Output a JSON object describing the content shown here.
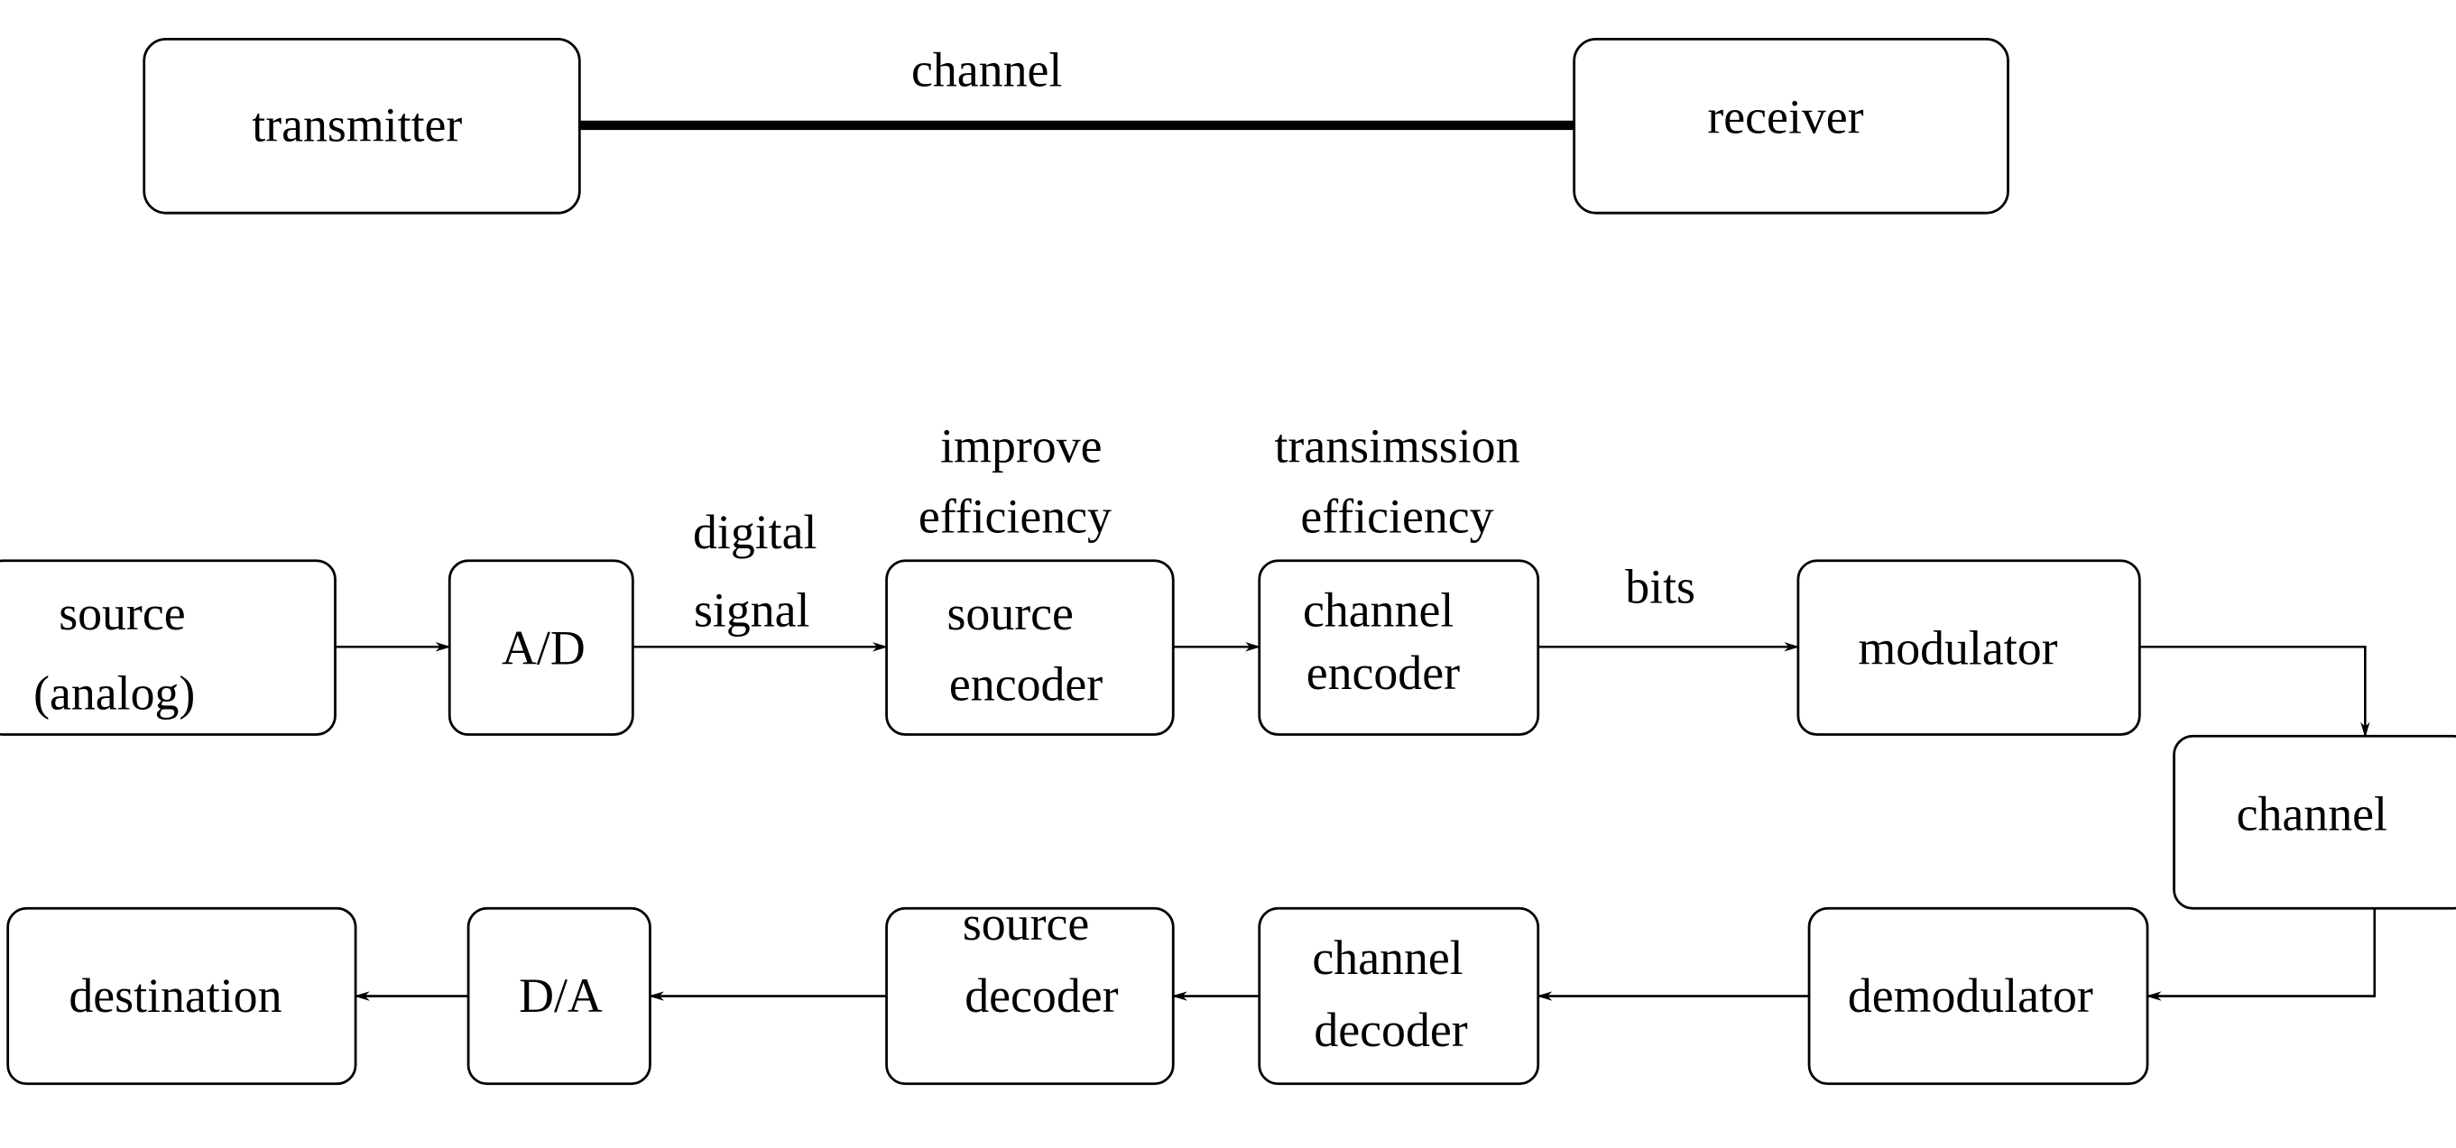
{
  "top": {
    "transmitter": "transmitter",
    "receiver": "receiver",
    "channel_label": "channel"
  },
  "chain": {
    "source": [
      "source",
      "(analog)"
    ],
    "ad": "A/D",
    "digital_signal": [
      "digital",
      "signal"
    ],
    "source_encoder": [
      "source",
      "encoder"
    ],
    "improve_efficiency": [
      "improve",
      "efficiency"
    ],
    "channel_encoder": [
      "channel",
      "encoder"
    ],
    "transmission_efficiency": [
      "transimssion",
      "efficiency"
    ],
    "bits": "bits",
    "modulator": "modulator",
    "channel": "channel",
    "demodulator": "demodulator",
    "channel_decoder": [
      "channel",
      "decoder"
    ],
    "source_decoder": [
      "source",
      "decoder"
    ],
    "da": "D/A",
    "destination": "destination"
  }
}
